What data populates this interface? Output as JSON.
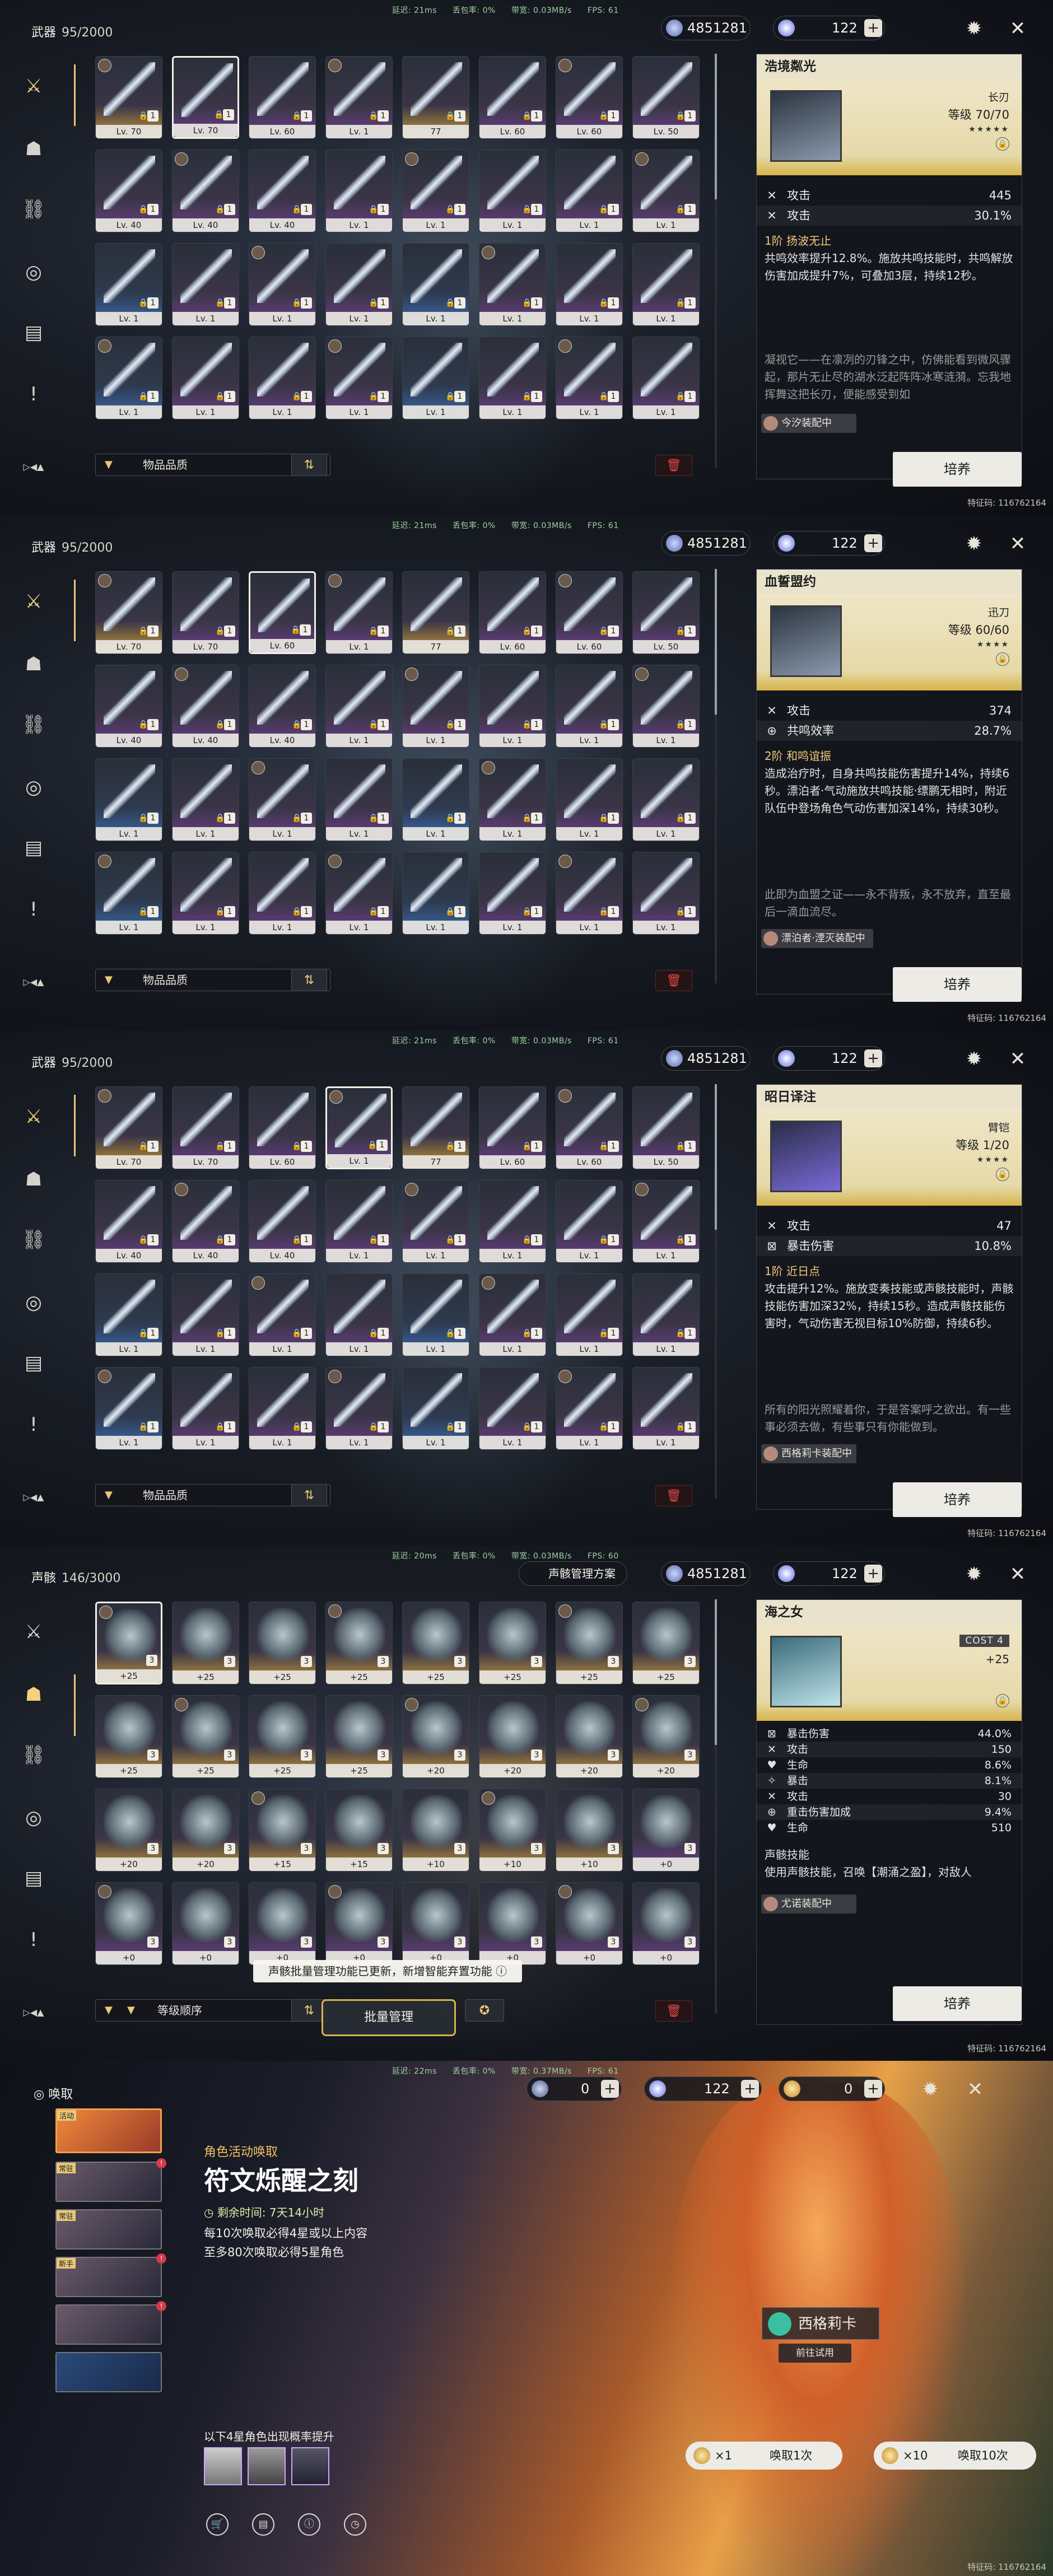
{
  "perf": {
    "latency": "延迟: 21ms",
    "loss": "丢包率: 0%",
    "bandwidth": "带宽: 0.03MB/s",
    "fps": "FPS: 61"
  },
  "uid": "特征码: 116762164",
  "currency": {
    "shell": "4851281",
    "astrite": "122",
    "lustrous": "0",
    "radiant": "0"
  },
  "nav_icons": [
    "sword-icon",
    "mask-icon",
    "chain-icon",
    "echo-icon",
    "backpack-icon",
    "quest-icon"
  ],
  "panel1": {
    "category": "武器",
    "count": "95/2000",
    "filter": "物品品质",
    "weapon": {
      "name": "浩境粼光",
      "type": "长刃",
      "level": "等级 70/70",
      "stars": "★★★★★",
      "stats": [
        {
          "name": "攻击",
          "value": "445"
        },
        {
          "name": "攻击",
          "value": "30.1%"
        }
      ],
      "skill_title": "1阶 扬波无止",
      "skill": "共鸣效率提升12.8%。施放共鸣技能时，共鸣解放伤害加成提升7%，可叠加3层，持续12秒。",
      "lore": "凝视它——在凛冽的刃锋之中，仿佛能看到微风骤起，那片无止尽的湖水泛起阵阵冰寒涟漪。忘我地挥舞这把长刃，便能感受到如",
      "equipped": "今汐装配中",
      "develop": "培养"
    },
    "levels": [
      "Lv. 70",
      "Lv. 70",
      "Lv. 60",
      "Lv. 1",
      "77",
      "Lv. 60",
      "Lv. 60",
      "Lv. 50",
      "Lv. 40",
      "Lv. 40",
      "Lv. 40",
      "Lv. 1",
      "Lv. 1",
      "Lv. 1",
      "Lv. 1",
      "Lv. 1",
      "Lv. 1",
      "Lv. 1",
      "Lv. 1",
      "Lv. 1",
      "Lv. 1",
      "Lv. 1",
      "Lv. 1",
      "Lv. 1",
      "Lv. 1",
      "Lv. 1",
      "Lv. 1",
      "Lv. 1",
      "Lv. 1",
      "Lv. 1",
      "Lv. 1",
      "Lv. 1"
    ]
  },
  "panel2": {
    "category": "武器",
    "count": "95/2000",
    "filter": "物品品质",
    "weapon": {
      "name": "血誓盟约",
      "type": "迅刀",
      "level": "等级 60/60",
      "stars": "★★★★",
      "stats": [
        {
          "name": "攻击",
          "value": "374"
        },
        {
          "name": "共鸣效率",
          "value": "28.7%"
        }
      ],
      "skill_title": "2阶 和鸣谊振",
      "skill": "造成治疗时，自身共鸣技能伤害提升14%，持续6秒。漂泊者·气动施放共鸣技能·缥鹏无相时，附近队伍中登场角色气动伤害加深14%，持续30秒。",
      "lore": "此即为血盟之证——永不背叛，永不放弃，直至最后一滴血流尽。",
      "equipped": "漂泊者·湮灭装配中",
      "develop": "培养"
    },
    "levels": [
      "Lv. 70",
      "Lv. 70",
      "Lv. 60",
      "Lv. 1",
      "77",
      "Lv. 60",
      "Lv. 60",
      "Lv. 50",
      "Lv. 40",
      "Lv. 40",
      "Lv. 40",
      "Lv. 1",
      "Lv. 1",
      "Lv. 1",
      "Lv. 1",
      "Lv. 1",
      "Lv. 1",
      "Lv. 1",
      "Lv. 1",
      "Lv. 1",
      "Lv. 1",
      "Lv. 1",
      "Lv. 1",
      "Lv. 1",
      "Lv. 1",
      "Lv. 1",
      "Lv. 1",
      "Lv. 1",
      "Lv. 1",
      "Lv. 1",
      "Lv. 1",
      "Lv. 1"
    ]
  },
  "panel3": {
    "category": "武器",
    "count": "95/2000",
    "filter": "物品品质",
    "weapon": {
      "name": "昭日译注",
      "type": "臂铠",
      "level": "等级 1/20",
      "stars": "★★★★",
      "stats": [
        {
          "name": "攻击",
          "value": "47"
        },
        {
          "name": "暴击伤害",
          "value": "10.8%"
        }
      ],
      "skill_title": "1阶 近日点",
      "skill": "攻击提升12%。施放变奏技能或声骸技能时，声骸技能伤害加深32%，持续15秒。造成声骸技能伤害时，气动伤害无视目标10%防御，持续6秒。",
      "lore": "所有的阳光照耀着你，于是答案呼之欲出。有一些事必须去做，有些事只有你能做到。",
      "equipped": "西格莉卡装配中",
      "develop": "培养"
    },
    "levels": [
      "Lv. 70",
      "Lv. 70",
      "Lv. 60",
      "Lv. 1",
      "77",
      "Lv. 60",
      "Lv. 60",
      "Lv. 50",
      "Lv. 40",
      "Lv. 40",
      "Lv. 40",
      "Lv. 1",
      "Lv. 1",
      "Lv. 1",
      "Lv. 1",
      "Lv. 1",
      "Lv. 1",
      "Lv. 1",
      "Lv. 1",
      "Lv. 1",
      "Lv. 1",
      "Lv. 1",
      "Lv. 1",
      "Lv. 1",
      "Lv. 1",
      "Lv. 1",
      "Lv. 1",
      "Lv. 1",
      "Lv. 1",
      "Lv. 1",
      "Lv. 1",
      "Lv. 1"
    ]
  },
  "panel4": {
    "perf": {
      "latency": "延迟: 20ms",
      "loss": "丢包率: 0%",
      "bandwidth": "带宽: 0.03MB/s",
      "fps": "FPS: 60"
    },
    "category": "声骸",
    "count": "146/3000",
    "plan": "声骸管理方案",
    "filter": "等级顺序",
    "batch": "批量管理",
    "toast": "声骸批量管理功能已更新，新增智能弃置功能",
    "echo": {
      "name": "海之女",
      "cost": "COST 4",
      "level": "+25",
      "stats": [
        {
          "name": "暴击伤害",
          "value": "44.0%"
        },
        {
          "name": "攻击",
          "value": "150"
        },
        {
          "name": "生命",
          "value": "8.6%"
        },
        {
          "name": "暴击",
          "value": "8.1%"
        },
        {
          "name": "攻击",
          "value": "30"
        },
        {
          "name": "重击伤害加成",
          "value": "9.4%"
        },
        {
          "name": "生命",
          "value": "510"
        }
      ],
      "skill_title": "声骸技能",
      "skill": "使用声骸技能，召唤【潮涌之盈】，对敌人",
      "equipped": "尤诺装配中",
      "develop": "培养"
    },
    "levels": [
      "+25",
      "+25",
      "+25",
      "+25",
      "+25",
      "+25",
      "+25",
      "+25",
      "+25",
      "+25",
      "+25",
      "+25",
      "+20",
      "+20",
      "+20",
      "+20",
      "+20",
      "+20",
      "+15",
      "+15",
      "+10",
      "+10",
      "+10",
      "+0",
      "+0",
      "+0",
      "+0",
      "+0",
      "+0",
      "+0",
      "+0",
      "+0"
    ]
  },
  "gacha": {
    "perf": {
      "latency": "延迟: 22ms",
      "loss": "丢包率: 0%",
      "bandwidth": "带宽: 0.37MB/s",
      "fps": "FPS: 61"
    },
    "title": "唤取",
    "event_label": "角色活动唤取",
    "banner_name": "符文烁醒之刻",
    "remaining": "剩余时间: 7天14小时",
    "rule1": "每10次唤取必得4星或以上内容",
    "rule2": "至多80次唤取必得5星角色",
    "rateup": "以下4星角色出现概率提升",
    "character": "西格莉卡",
    "trial": "前往试用",
    "pull1_cost": "×1",
    "pull1": "唤取1次",
    "pull10_cost": "×10",
    "pull10": "唤取10次",
    "banner_tags": [
      "活动",
      "常驻",
      "常驻",
      "新手",
      "",
      ""
    ]
  }
}
